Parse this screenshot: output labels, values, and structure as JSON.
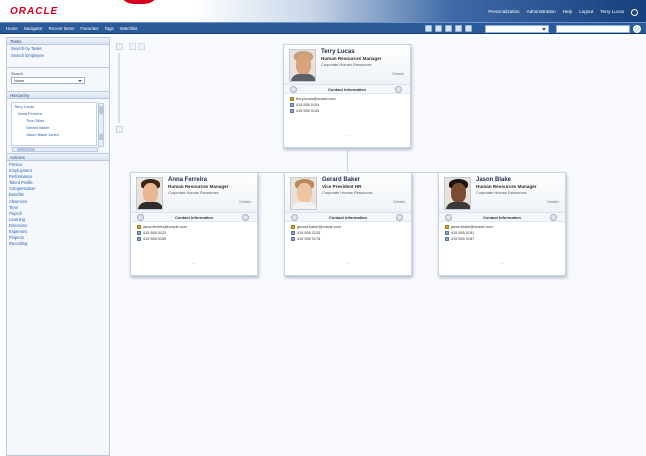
{
  "brand": {
    "logo_text": "ORACLE"
  },
  "global_links": [
    "Personalization",
    "Administration",
    "Help",
    "Logout",
    "Terry Lucas"
  ],
  "nav": {
    "menus": [
      "Home",
      "Navigator",
      "Recent Items",
      "Favorites",
      "Tags",
      "Watchlist"
    ],
    "search_category": "",
    "search_placeholder": ""
  },
  "left_panel": {
    "tasks_title": "Tasks",
    "tasks": [
      "Search by Tasks",
      "Search Employee"
    ],
    "search_label": "Search",
    "search_value": "Name",
    "hierarchy_title": "Hierarchy",
    "hierarchy_items": [
      "Terry Lucas",
      "Anna Ferreira",
      "Tina Gilles",
      "Gerard Baker",
      "Jason Blake Jones"
    ],
    "actions_title": "Actions",
    "actions": [
      "Person",
      "Employment",
      "Performance",
      "Talent Profile",
      "Compensation",
      "Benefits",
      "Absences",
      "Time",
      "Payroll",
      "Learning",
      "Directions",
      "Expenses",
      "Projects",
      "Recruiting"
    ]
  },
  "cards": [
    {
      "name": "Terry Lucas",
      "title": "Human Resources Manager",
      "department": "Corporate Human Resources",
      "details_label": "Details",
      "contact_label": "Contact Information",
      "email": "terry.lucas@oracle.com",
      "phone": "415 555 0104",
      "mobile": "415 555 0145"
    },
    {
      "name": "Anna Ferreira",
      "title": "Human Resources Manager",
      "department": "Corporate Human Resources",
      "details_label": "Details",
      "contact_label": "Contact Information",
      "email": "anna.ferreira@oracle.com",
      "phone": "415 555 0122",
      "mobile": "415 555 0169"
    },
    {
      "name": "Gerard Baker",
      "title": "Vice President HR",
      "department": "Corporate Human Resources",
      "details_label": "Details",
      "contact_label": "Contact Information",
      "email": "gerard.baker@oracle.com",
      "phone": "415 555 0133",
      "mobile": "415 555 0178"
    },
    {
      "name": "Jason Blake",
      "title": "Human Resources Manager",
      "department": "Corporate Human Resources",
      "details_label": "Details",
      "contact_label": "Contact Information",
      "email": "jason.blake@oracle.com",
      "phone": "415 555 0151",
      "mobile": "415 555 0187"
    }
  ]
}
